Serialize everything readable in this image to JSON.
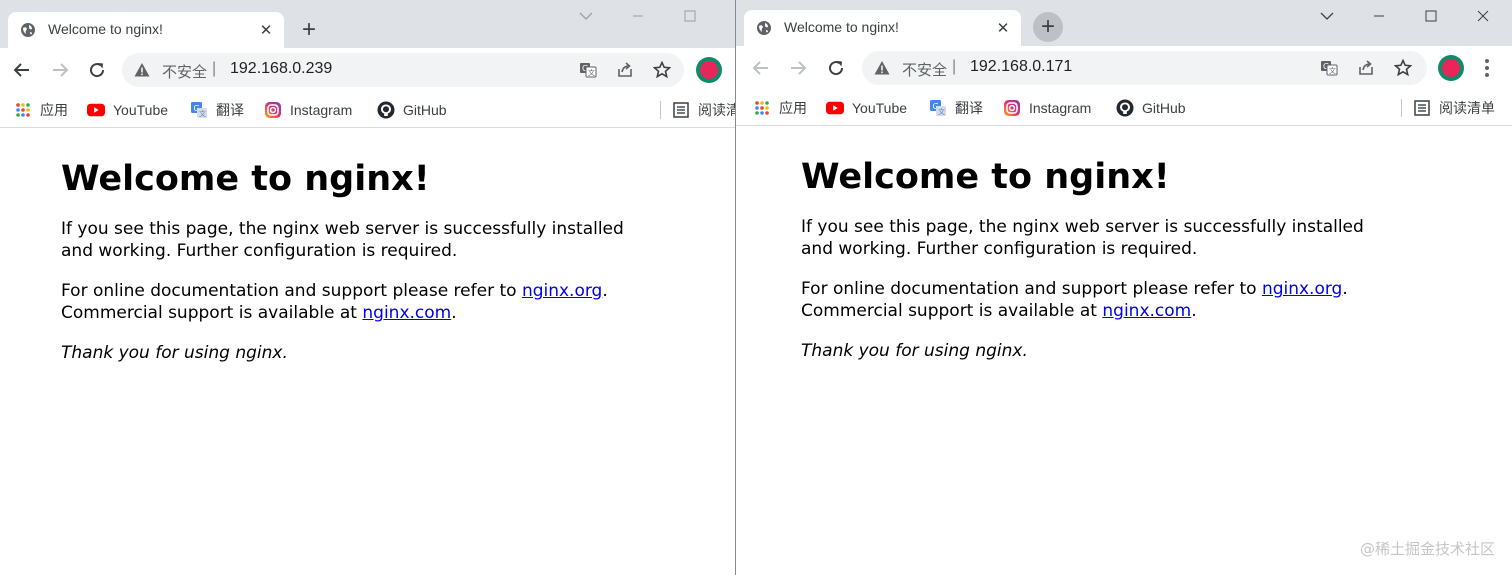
{
  "browsers": {
    "left": {
      "tab_title": "Welcome to nginx!",
      "omnibox": {
        "insecure_label": "不安全",
        "separator": "|",
        "url": "192.168.0.239"
      },
      "bookmarks": [
        {
          "label": "应用",
          "icon": "apps-grid-icon"
        },
        {
          "label": "YouTube",
          "icon": "youtube-icon"
        },
        {
          "label": "翻译",
          "icon": "translate-icon"
        },
        {
          "label": "Instagram",
          "icon": "instagram-icon"
        },
        {
          "label": "GitHub",
          "icon": "github-icon"
        }
      ],
      "reading_list_label": "阅读清"
    },
    "right": {
      "tab_title": "Welcome to nginx!",
      "omnibox": {
        "insecure_label": "不安全",
        "separator": "|",
        "url": "192.168.0.171"
      },
      "bookmarks": [
        {
          "label": "应用",
          "icon": "apps-grid-icon"
        },
        {
          "label": "YouTube",
          "icon": "youtube-icon"
        },
        {
          "label": "翻译",
          "icon": "translate-icon"
        },
        {
          "label": "Instagram",
          "icon": "instagram-icon"
        },
        {
          "label": "GitHub",
          "icon": "github-icon"
        }
      ],
      "reading_list_label": "阅读清单"
    }
  },
  "nginx_page": {
    "heading": "Welcome to nginx!",
    "paragraph1": "If you see this page, the nginx web server is successfully installed and working. Further configuration is required.",
    "p2_prefix": "For online documentation and support please refer to ",
    "p2_link1": "nginx.org",
    "p2_mid": ".",
    "p2_line2_prefix": "Commercial support is available at ",
    "p2_link2": "nginx.com",
    "p2_suffix": ".",
    "thanks": "Thank you for using nginx."
  },
  "watermark": "@稀土掘金技术社区",
  "colors": {
    "link": "#0000ee",
    "tabstrip": "#dee1e6",
    "omnibox": "#f1f3f4",
    "profile_ring": "#0f8b6a",
    "profile_fill": "#e8265a"
  }
}
